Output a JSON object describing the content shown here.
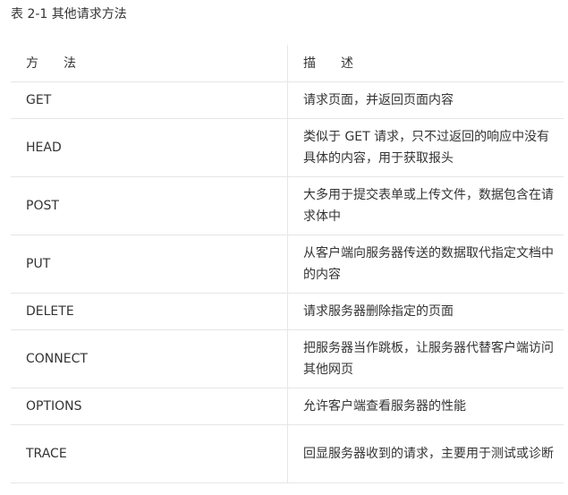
{
  "caption": "表 2-1 其他请求方法",
  "table": {
    "headers": [
      "方　　法",
      "描　　述"
    ],
    "rows": [
      {
        "method": "GET",
        "description": "请求页面，并返回页面内容"
      },
      {
        "method": "HEAD",
        "description": "类似于 GET 请求，只不过返回的响应中没有具体的内容，用于获取报头"
      },
      {
        "method": "POST",
        "description": "大多用于提交表单或上传文件，数据包含在请求体中"
      },
      {
        "method": "PUT",
        "description": "从客户端向服务器传送的数据取代指定文档中的内容"
      },
      {
        "method": "DELETE",
        "description": "请求服务器删除指定的页面"
      },
      {
        "method": "CONNECT",
        "description": "把服务器当作跳板，让服务器代替客户端访问其他网页"
      },
      {
        "method": "OPTIONS",
        "description": "允许客户端查看服务器的性能"
      },
      {
        "method": "TRACE",
        "description": "回显服务器收到的请求，主要用于测试或诊断"
      }
    ]
  }
}
